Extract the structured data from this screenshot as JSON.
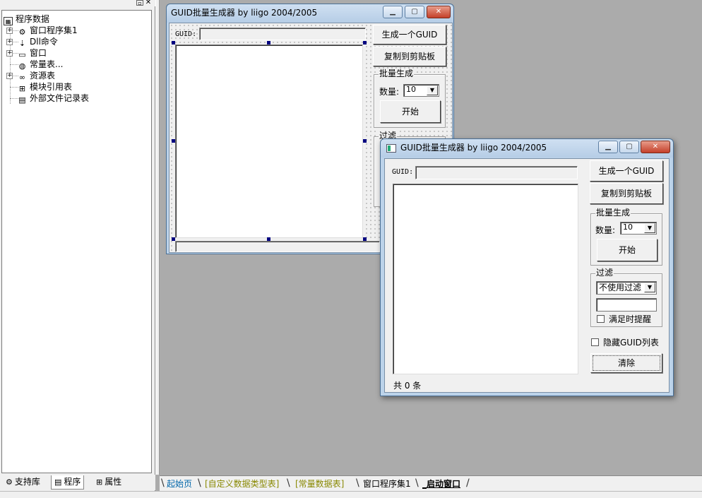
{
  "top_controls": {
    "min": "▫",
    "close": "✕"
  },
  "tree": {
    "root": "程序数据",
    "items": [
      {
        "label": "窗口程序集1",
        "icon": "assembly-icon",
        "glyph": "⚙"
      },
      {
        "label": "Dll命令",
        "icon": "dll-command-icon",
        "glyph": "⇣"
      },
      {
        "label": "窗口",
        "icon": "window-icon",
        "glyph": "▭"
      },
      {
        "label": "常量表...",
        "icon": "constant-table-icon",
        "glyph": "◍"
      },
      {
        "label": "资源表",
        "icon": "resource-table-icon",
        "glyph": "∞"
      },
      {
        "label": "模块引用表",
        "icon": "module-ref-icon",
        "glyph": "⊞"
      },
      {
        "label": "外部文件记录表",
        "icon": "external-file-icon",
        "glyph": "▤"
      }
    ]
  },
  "left_tabs": [
    {
      "label": "支持库",
      "glyph": "⚙"
    },
    {
      "label": "程序",
      "glyph": "▤"
    },
    {
      "label": "属性",
      "glyph": "⊞"
    }
  ],
  "bottom_tabs": [
    {
      "label": "起始页"
    },
    {
      "label": "[自定义数据类型表]"
    },
    {
      "label": "[常量数据表]"
    },
    {
      "label": "窗口程序集1"
    },
    {
      "label": "_启动窗口"
    }
  ],
  "design_window": {
    "title": "GUID批量生成器 by liigo 2004/2005",
    "guid_label": "GUID:",
    "btn_generate": "生成一个GUID",
    "btn_copy": "复制到剪贴板",
    "batch_group": "批量生成",
    "count_label": "数量:",
    "count_value": "10",
    "btn_start": "开始",
    "filter_group": "过滤"
  },
  "run_window": {
    "title": "GUID批量生成器 by liigo 2004/2005",
    "guid_label": "GUID:",
    "btn_generate": "生成一个GUID",
    "btn_copy": "复制到剪贴板",
    "batch_group": "批量生成",
    "count_label": "数量:",
    "count_value": "10",
    "btn_start": "开始",
    "filter_group": "过滤",
    "filter_value": "不使用过滤",
    "alert_check": "满足时提醒",
    "hide_check": "隐藏GUID列表",
    "btn_clear": "清除",
    "status_text": "共 0 条"
  },
  "caption_buttons": {
    "min": "▁",
    "max": "▢",
    "close": "✕"
  }
}
